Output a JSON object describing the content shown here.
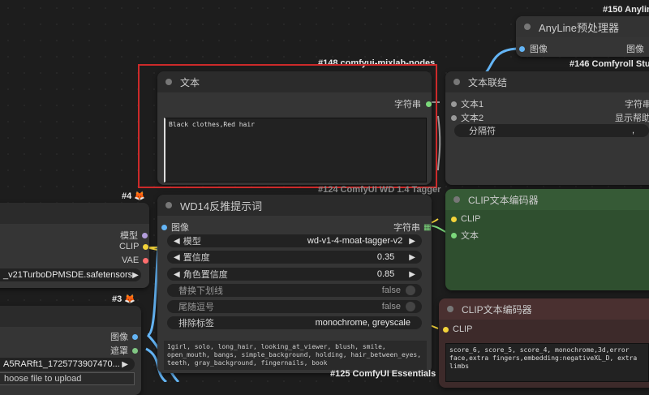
{
  "ids": {
    "n150": "#150 Anylin",
    "n148": "#148 comfyui-mixlab-nodes",
    "n146": "#146 Comfyroll Studi",
    "n4": "#4",
    "n3": "#3",
    "n125": "#125 ComfyUI Essentials",
    "n124": "#124 ComfyUI WD 1.4 Tagger"
  },
  "anyline": {
    "title": "AnyLine预处理器",
    "input": "图像",
    "output": "图像"
  },
  "text_node": {
    "title": "文本",
    "output": "字符串",
    "value": "Black clothes,Red hair"
  },
  "concat_node": {
    "title": "文本联结",
    "in1": "文本1",
    "in2": "文本2",
    "out1": "字符串",
    "out2": "显示帮助",
    "sep_label": "分隔符",
    "sep_value": ","
  },
  "clip_green": {
    "title": "CLIP文本编码器",
    "in_clip": "CLIP",
    "in_text": "文本"
  },
  "clip_red": {
    "title": "CLIP文本编码器",
    "in_clip": "CLIP",
    "text": "score_6, score_5, score_4, monochrome,3d,error face,extra fingers,embedding:negativeXL_D, extra limbs"
  },
  "ckpt_node": {
    "out_model": "模型",
    "out_clip": "CLIP",
    "out_vae": "VAE",
    "ckpt_value": "_v21TurboDPMSDE.safetensors"
  },
  "load_node": {
    "out_image": "图像",
    "out_mask": "遮罩",
    "file_value": "A5RARft1_1725773907470...",
    "upload_label": "hoose file to upload"
  },
  "wd14": {
    "title": "WD14反推提示词",
    "input": "图像",
    "output": "字符串",
    "widgets": [
      {
        "label": "模型",
        "value": "wd-v1-4-moat-tagger-v2"
      },
      {
        "label": "置信度",
        "value": "0.35"
      },
      {
        "label": "角色置信度",
        "value": "0.85"
      },
      {
        "label": "替换下划线",
        "value": "false"
      },
      {
        "label": "尾随逗号",
        "value": "false"
      },
      {
        "label": "排除标签",
        "value": "monochrome, greyscale"
      }
    ],
    "output_text": "1girl, solo, long_hair, looking_at_viewer, blush, smile, open_mouth, bangs, simple_background, holding, hair_between_eyes, teeth, gray_background, fingernails, book"
  },
  "colors": {
    "highlight": "#cc2a2a",
    "clip_slot": "#f3d33a",
    "model_slot": "#b39ddb",
    "vae_slot": "#ff6e6e",
    "image_slot": "#64b5f6",
    "string_slot": "#7bd97b",
    "green_node": "#335533",
    "red_node": "#553333"
  }
}
